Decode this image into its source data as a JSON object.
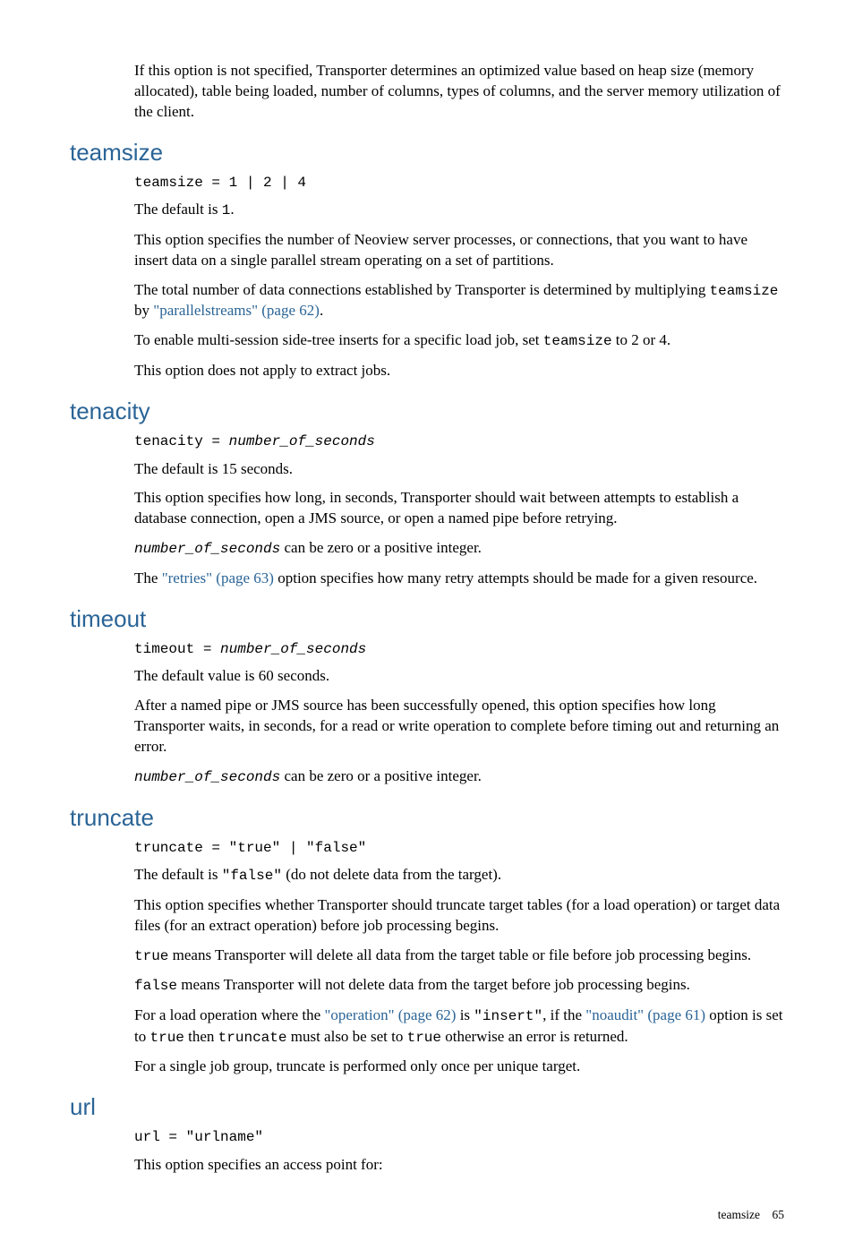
{
  "intro": {
    "p1": "If this option is not specified, Transporter determines an optimized value based on heap size (memory allocated), table being loaded, number of columns, types of columns, and the server memory utilization of the client."
  },
  "sections": {
    "teamsize": {
      "heading": "teamsize",
      "syntax": "teamsize = 1 | 2 | 4",
      "p1a": "The default is ",
      "p1b": "1",
      "p1c": ".",
      "p2": "This option specifies the number of Neoview server processes, or connections, that you want to have insert data on a single parallel stream operating on a set of partitions.",
      "p3a": "The total number of data connections established by Transporter is determined by multiplying ",
      "p3b": "teamsize",
      "p3c": " by ",
      "p3link": "\"parallelstreams\" (page 62)",
      "p3d": ".",
      "p4a": "To enable multi-session side-tree inserts for a specific load job, set ",
      "p4b": "teamsize",
      "p4c": " to 2 or 4.",
      "p5": "This option does not apply to extract jobs."
    },
    "tenacity": {
      "heading": "tenacity",
      "syntax_a": "tenacity = ",
      "syntax_b": "number_of_seconds",
      "p1": "The default is 15 seconds.",
      "p2": "This option specifies how long, in seconds, Transporter should wait between attempts to establish a database connection, open a JMS source, or open a named pipe before retrying.",
      "p3a": "number_of_seconds",
      "p3b": " can be zero or a positive integer.",
      "p4a": "The ",
      "p4link": "\"retries\" (page 63)",
      "p4b": " option specifies how many retry attempts should be made for a given resource."
    },
    "timeout": {
      "heading": "timeout",
      "syntax_a": "timeout = ",
      "syntax_b": "number_of_seconds",
      "p1": "The default value is 60 seconds.",
      "p2": "After a named pipe or JMS source has been successfully opened, this option specifies how long Transporter waits, in seconds, for a read or write operation to complete before timing out and returning an error.",
      "p3a": "number_of_seconds",
      "p3b": " can be zero or a positive integer."
    },
    "truncate": {
      "heading": "truncate",
      "syntax": "truncate = \"true\" | \"false\"",
      "p1a": "The default is  ",
      "p1b": "\"false\"",
      "p1c": " (do not delete data from the target).",
      "p2": "This option specifies whether Transporter should truncate target tables (for a load operation) or target data files (for an extract operation) before job processing begins.",
      "p3a": "true",
      "p3b": " means Transporter will delete all data from the target table or file before job processing begins.",
      "p4a": "false",
      "p4b": " means Transporter will not delete data from the target before job processing begins.",
      "p5a": "For a load operation where the ",
      "p5link1": "\"operation\" (page 62)",
      "p5b": " is ",
      "p5c": "\"insert\"",
      "p5d": ", if the ",
      "p5link2": "\"noaudit\" (page 61)",
      "p5e": " option is set to ",
      "p5f": "true",
      "p5g": " then ",
      "p5h": "truncate",
      "p5i": " must also be set to ",
      "p5j": "true",
      "p5k": " otherwise an error is returned.",
      "p6": "For a single job group, truncate is performed only once per unique target."
    },
    "url": {
      "heading": "url",
      "syntax": "url = \"urlname\"",
      "p1": "This option specifies an access point for:"
    }
  },
  "footer": {
    "label": "teamsize",
    "page": "65"
  }
}
